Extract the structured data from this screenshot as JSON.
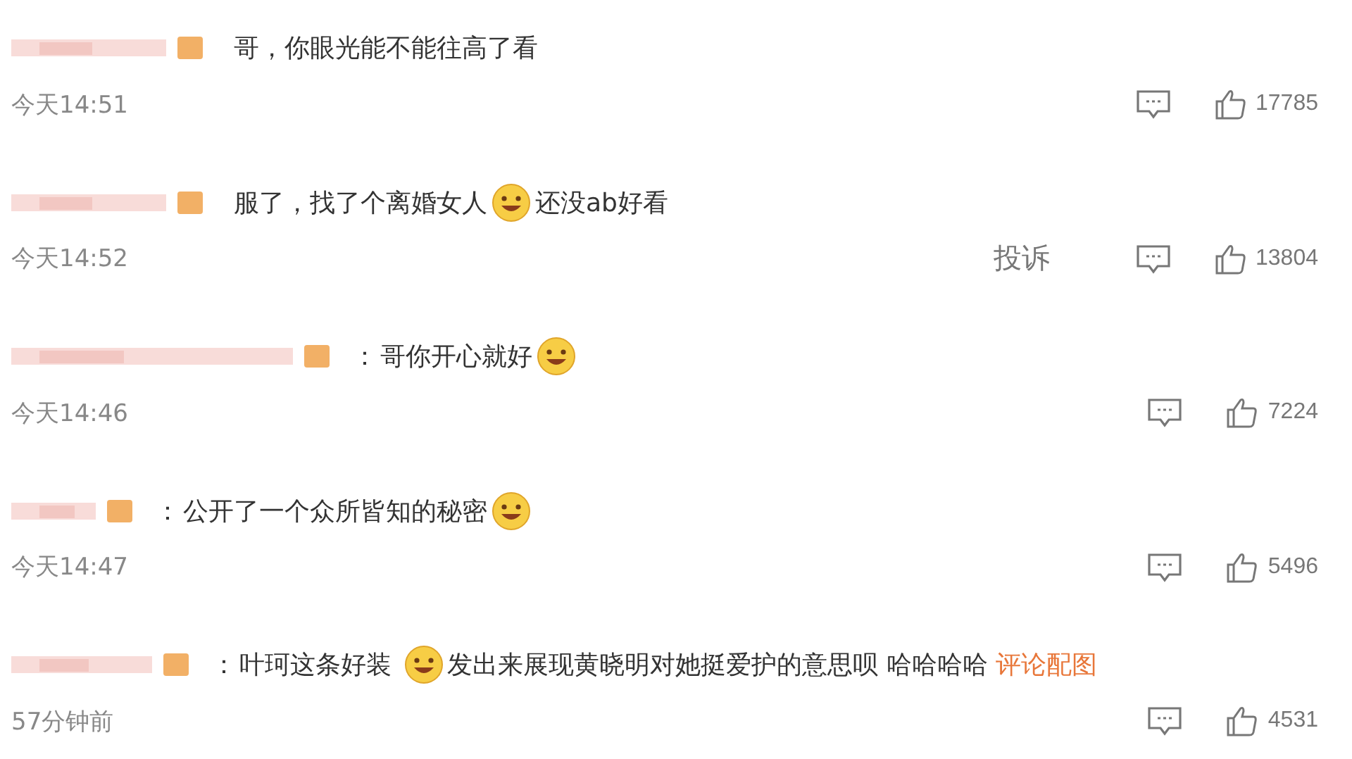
{
  "comments": [
    {
      "content": [
        {
          "kind": "text",
          "text": "哥，你眼光能不能往高了看"
        }
      ],
      "time": "今天14:51",
      "likes": "17785"
    },
    {
      "content": [
        {
          "kind": "text",
          "text": "服了，找了个离婚女人"
        },
        {
          "kind": "emoji"
        },
        {
          "kind": "text",
          "text": "还没ab好看"
        }
      ],
      "time": "今天14:52",
      "report": "投诉",
      "likes": "13804"
    },
    {
      "colon": "：",
      "content": [
        {
          "kind": "text",
          "text": "哥你开心就好"
        },
        {
          "kind": "emoji"
        }
      ],
      "time": "今天14:46",
      "likes": "7224"
    },
    {
      "colon": "：",
      "content": [
        {
          "kind": "text",
          "text": "公开了一个众所皆知的秘密"
        },
        {
          "kind": "emoji"
        }
      ],
      "time": "今天14:47",
      "likes": "5496"
    },
    {
      "colon": "：",
      "content": [
        {
          "kind": "text",
          "text": "叶珂这条好装 "
        },
        {
          "kind": "emoji"
        },
        {
          "kind": "text",
          "text": "发出来展现黄晓明对她挺爱护的意思呗 哈哈哈哈 "
        },
        {
          "kind": "link",
          "text": "评论配图"
        }
      ],
      "time": "57分钟前",
      "likes": "4531"
    }
  ]
}
